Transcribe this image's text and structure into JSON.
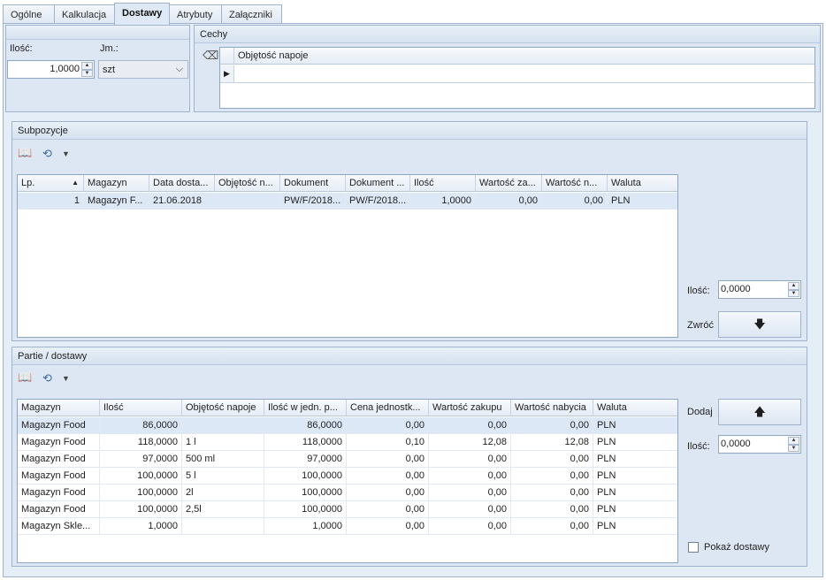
{
  "tabs": [
    "Ogólne",
    "Kalkulacja",
    "Dostawy",
    "Atrybuty",
    "Załączniki"
  ],
  "active_tab": "Dostawy",
  "quantity": {
    "label": "Ilość:",
    "value": "1,0000"
  },
  "unit": {
    "label": "Jm.:",
    "value": "szt"
  },
  "features": {
    "title": "Cechy",
    "column": "Objętość napoje"
  },
  "subpositions": {
    "title": "Subpozycje",
    "columns": [
      "Lp.",
      "Magazyn",
      "Data dosta...",
      "Objętość n...",
      "Dokument",
      "Dokument ...",
      "Ilość",
      "Wartość za...",
      "Wartość n...",
      "Waluta"
    ],
    "rows": [
      [
        "1",
        "Magazyn F...",
        "21.06.2018",
        "",
        "PW/F/2018...",
        "PW/F/2018...",
        "1,0000",
        "0,00",
        "0,00",
        "PLN"
      ]
    ],
    "qty_label": "Ilość:",
    "qty_value": "0,0000",
    "return_label": "Zwróć"
  },
  "batches": {
    "title": "Partie / dostawy",
    "columns": [
      "Magazyn",
      "Ilość",
      "Objętość napoje",
      "Ilość w jedn. p...",
      "Cena jednostk...",
      "Wartość zakupu",
      "Wartość nabycia",
      "Waluta"
    ],
    "rows": [
      [
        "Magazyn Food",
        "86,0000",
        "",
        "86,0000",
        "0,00",
        "0,00",
        "0,00",
        "PLN"
      ],
      [
        "Magazyn Food",
        "118,0000",
        "1 l",
        "118,0000",
        "0,10",
        "12,08",
        "12,08",
        "PLN"
      ],
      [
        "Magazyn Food",
        "97,0000",
        "500 ml",
        "97,0000",
        "0,00",
        "0,00",
        "0,00",
        "PLN"
      ],
      [
        "Magazyn Food",
        "100,0000",
        "5 l",
        "100,0000",
        "0,00",
        "0,00",
        "0,00",
        "PLN"
      ],
      [
        "Magazyn Food",
        "100,0000",
        "2l",
        "100,0000",
        "0,00",
        "0,00",
        "0,00",
        "PLN"
      ],
      [
        "Magazyn Food",
        "100,0000",
        "2,5l",
        "100,0000",
        "0,00",
        "0,00",
        "0,00",
        "PLN"
      ],
      [
        "Magazyn Skle...",
        "1,0000",
        "",
        "1,0000",
        "0,00",
        "0,00",
        "0,00",
        "PLN"
      ]
    ],
    "add_label": "Dodaj",
    "qty_label": "Ilość:",
    "qty_value": "0,0000",
    "show_deliveries_label": "Pokaż dostawy"
  }
}
